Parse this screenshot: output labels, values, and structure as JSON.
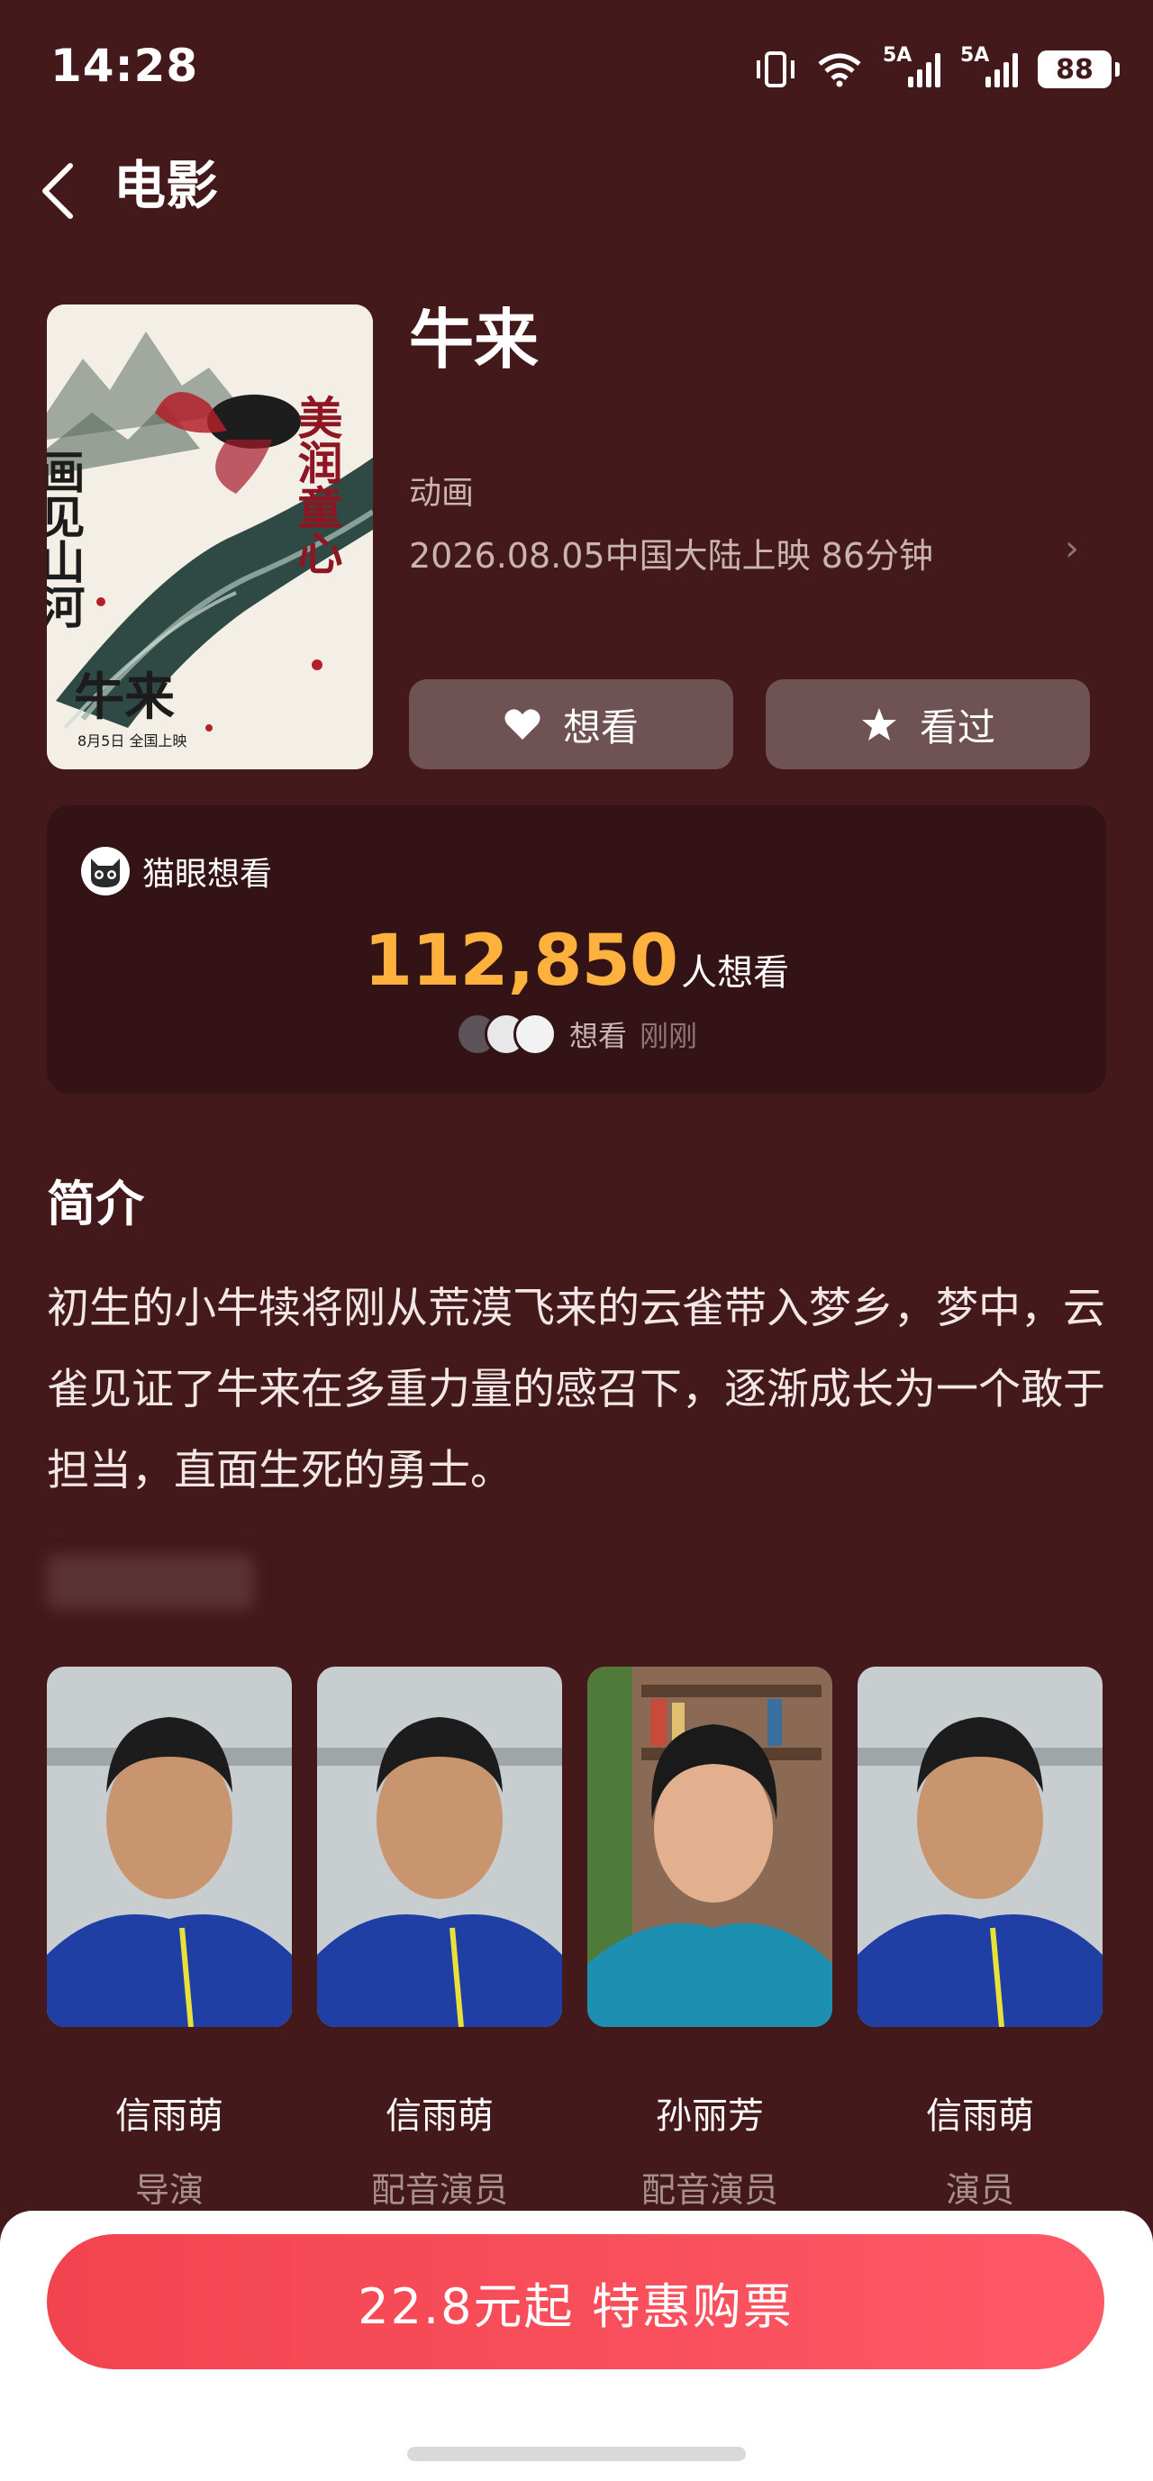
{
  "status_bar": {
    "time": "14:28",
    "signal_1_label": "5A",
    "signal_2_label": "5A",
    "battery": "88"
  },
  "header": {
    "back_icon": "chevron-left-icon",
    "title": "电影"
  },
  "movie": {
    "title": "牛来",
    "genre": "动画",
    "release": "2026.08.05中国大陆上映 86分钟",
    "poster_text": {
      "left": "画见山河",
      "right": "美润童心",
      "bottom": "牛来",
      "date": "8月5日 全国上映"
    }
  },
  "actions": {
    "want_label": "想看",
    "seen_label": "看过"
  },
  "maoyan": {
    "title": "猫眼想看",
    "count": "112,850",
    "count_suffix": "人想看",
    "recent_label": "想看",
    "recent_time": "刚刚"
  },
  "synopsis": {
    "title": "简介",
    "text": "初生的小牛犊将刚从荒漠飞来的云雀带入梦乡，梦中，云雀见证了牛来在多重力量的感召下，逐渐成长为一个敢于担当，直面生死的勇士。"
  },
  "cast": [
    {
      "name": "信雨萌",
      "role": "导演"
    },
    {
      "name": "信雨萌",
      "role": "配音演员"
    },
    {
      "name": "孙丽芳",
      "role": "配音演员"
    },
    {
      "name": "信雨萌",
      "role": "演员"
    }
  ],
  "buy": {
    "label": "22.8元起 特惠购票"
  },
  "colors": {
    "background": "#43191b",
    "card": "#331315",
    "accent_count": "#ffb13d",
    "buy_button": "#f84b57"
  }
}
